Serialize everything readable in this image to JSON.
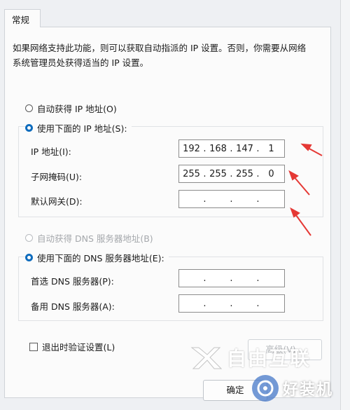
{
  "tab": {
    "label": "常规"
  },
  "description": "如果网络支持此功能，则可以获取自动指派的 IP 设置。否则，你需要从网络系统管理员处获得适当的 IP 设置。",
  "ip_section": {
    "auto_label": "自动获得 IP 地址(O)",
    "manual_label": "使用下面的 IP 地址(S):",
    "selected": "manual",
    "fields": [
      {
        "label": "IP 地址(I):",
        "octets": [
          "192",
          "168",
          "147",
          "1"
        ]
      },
      {
        "label": "子网掩码(U):",
        "octets": [
          "255",
          "255",
          "255",
          "0"
        ]
      },
      {
        "label": "默认网关(D):",
        "octets": [
          "",
          "",
          "",
          ""
        ]
      }
    ]
  },
  "dns_section": {
    "auto_label": "自动获得 DNS 服务器地址(B)",
    "manual_label": "使用下面的 DNS 服务器地址(E):",
    "selected": "manual",
    "fields": [
      {
        "label": "首选 DNS 服务器(P):",
        "octets": [
          "",
          "",
          "",
          ""
        ]
      },
      {
        "label": "备用 DNS 服务器(A):",
        "octets": [
          "",
          "",
          "",
          ""
        ]
      }
    ]
  },
  "validate_checkbox": {
    "label": "退出时验证设置(L)",
    "checked": false
  },
  "buttons": {
    "advanced": "高级(V)...",
    "ok": "确定"
  },
  "watermarks": {
    "brand1": "自由互联",
    "brand2": "好装机"
  },
  "colors": {
    "accent": "#0f6cbd",
    "annotation_arrow": "#e53935"
  }
}
